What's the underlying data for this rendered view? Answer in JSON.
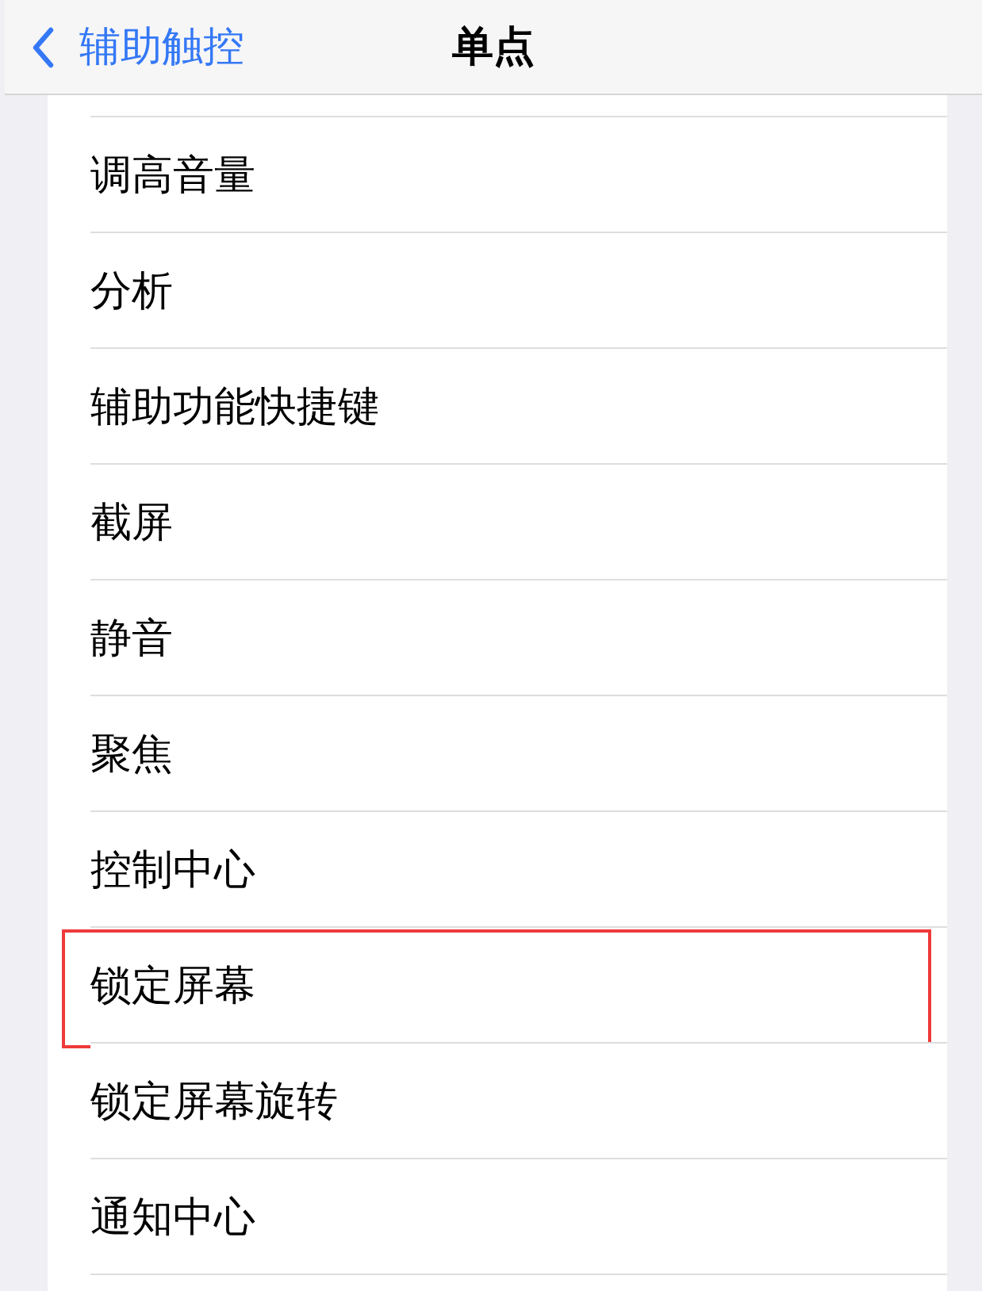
{
  "nav": {
    "back_label": "辅助触控",
    "title": "单点"
  },
  "items": [
    {
      "label": "调高音量",
      "highlighted": false
    },
    {
      "label": "分析",
      "highlighted": false
    },
    {
      "label": "辅助功能快捷键",
      "highlighted": false
    },
    {
      "label": "截屏",
      "highlighted": false
    },
    {
      "label": "静音",
      "highlighted": false
    },
    {
      "label": "聚焦",
      "highlighted": false
    },
    {
      "label": "控制中心",
      "highlighted": false
    },
    {
      "label": "锁定屏幕",
      "highlighted": true
    },
    {
      "label": "锁定屏幕旋转",
      "highlighted": false
    },
    {
      "label": "通知中心",
      "highlighted": false
    }
  ]
}
